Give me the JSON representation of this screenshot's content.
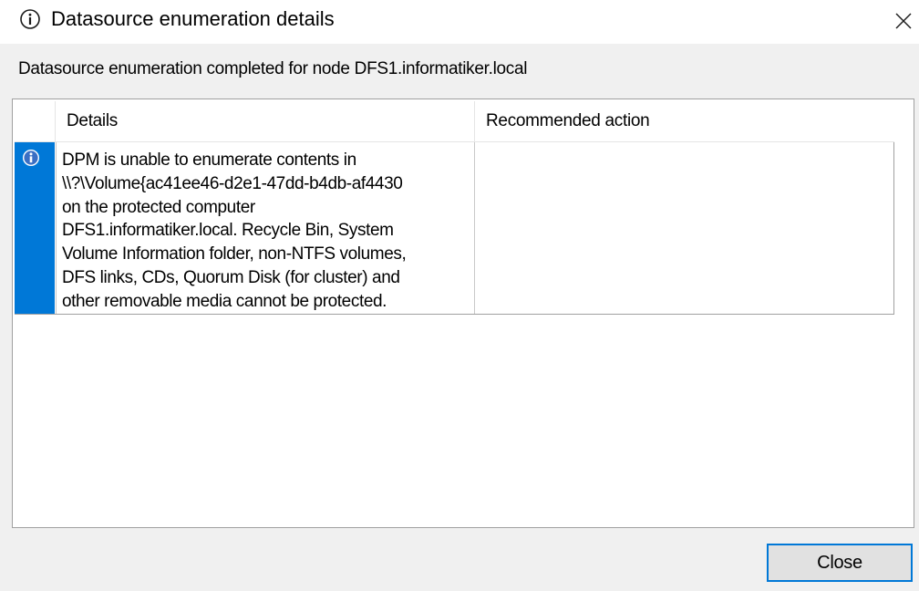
{
  "window": {
    "title": "Datasource enumeration details",
    "title_icon": "info-circle-icon",
    "close_icon": "close-x-icon"
  },
  "message": "Datasource enumeration completed for node DFS1.informatiker.local",
  "table": {
    "columns": [
      "",
      "Details",
      "Recommended action"
    ],
    "rows": [
      {
        "icon": "info-icon",
        "details_lines": [
          "DPM is unable to enumerate contents in",
          "\\\\?\\Volume{ac41ee46-d2e1-47dd-b4db-af4430",
          "on the protected computer",
          "DFS1.informatiker.local. Recycle Bin, System",
          "Volume Information folder, non-NTFS volumes,",
          "DFS links, CDs, Quorum Disk (for cluster) and",
          "other removable media cannot be protected."
        ],
        "recommended_action": ""
      }
    ]
  },
  "buttons": {
    "close_label": "Close"
  },
  "colors": {
    "accent": "#0078d7",
    "selection": "#0078d7",
    "background": "#f0f0f0"
  }
}
